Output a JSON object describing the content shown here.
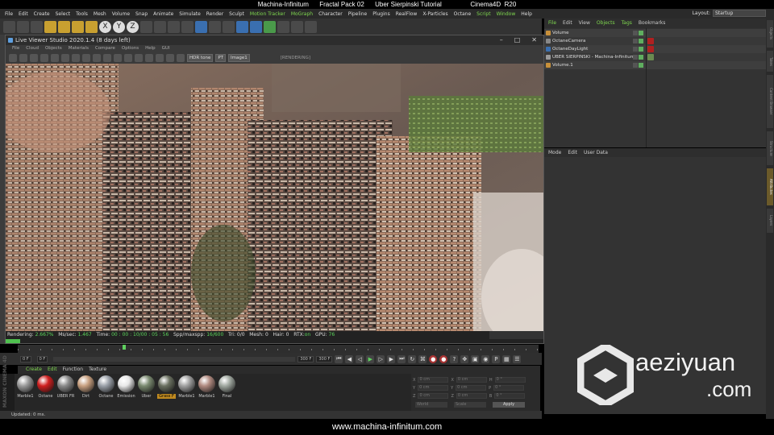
{
  "top_caption": "Machina-Infinitum      Fractal Pack 02      Uber Sierpinski Tutorial                Cinema4D  R20",
  "menubar": {
    "items": [
      "File",
      "Edit",
      "Create",
      "Select",
      "Tools",
      "Mesh",
      "Volume",
      "Snap",
      "Animate",
      "Simulate",
      "Render",
      "Sculpt",
      "Motion Tracker",
      "MoGraph",
      "Character",
      "Pipeline",
      "Plugins",
      "RealFlow",
      "X-Particles",
      "Octane",
      "Script",
      "Window",
      "Help"
    ],
    "highlighted": [
      "Motion Tracker",
      "MoGraph",
      "Script",
      "Window"
    ],
    "layout_label": "Layout:",
    "layout_value": "Startup"
  },
  "toolbar": {
    "icons": [
      "undo-icon",
      "redo-icon",
      "select-icon",
      "move-icon",
      "scale-icon",
      "rotate-icon",
      "add-icon",
      "x-axis-icon",
      "y-axis-icon",
      "z-axis-icon",
      "coord-system-icon",
      "render-region-icon",
      "render-view-icon",
      "render-settings-icon",
      "cube-icon",
      "pen-icon",
      "subdivide-icon",
      "cloner-icon",
      "deformer-icon",
      "scene-icon",
      "floor-icon",
      "camera-icon",
      "light-icon"
    ],
    "axis_labels": [
      "X",
      "Y",
      "Z"
    ]
  },
  "live_viewer": {
    "title": "Live Viewer Studio 2020.1.4 (8 days left)",
    "menu": [
      "File",
      "Cloud",
      "Objects",
      "Materials",
      "Compare",
      "Options",
      "Help",
      "GUI"
    ],
    "rendering_tag": "[RENDERING]",
    "tone": "HDR tone",
    "kernel": "PT",
    "image_slot": "Image1",
    "status": {
      "rendering_label": "Rendering: ",
      "rendering_value": "2.667%",
      "ms_label": "   Ms/sec: ",
      "ms_value": "1.467",
      "time_label": "   Time: ",
      "time_value": "00 : 00 : 10/00 : 05 : 56",
      "spp_label": "   Spp/maxspp: ",
      "spp_value": "16/600",
      "tri": "   Tri: 0/0   Mesh: 0   Hair: 0   RTX:",
      "rtx_value": "on",
      "gpu_label": "   GPU: ",
      "gpu_value": "76"
    },
    "progress": 0.02667
  },
  "transport": {
    "start_frame": "0 F",
    "current_frame": "0 F",
    "end_frame": "300 F",
    "end_frame2": "300 F"
  },
  "material_manager": {
    "menu": [
      "Create",
      "Edit",
      "Function",
      "Texture"
    ],
    "materials": [
      {
        "name": "Marble1",
        "color": "#9a9a9a"
      },
      {
        "name": "Octane",
        "color": "#d02020"
      },
      {
        "name": "UBER FR",
        "color": "#8a8a8a"
      },
      {
        "name": "Dirt",
        "color": "#c8a080"
      },
      {
        "name": "Octane",
        "color": "#9aa0a8"
      },
      {
        "name": "Emission",
        "color": "#e8e8e8"
      },
      {
        "name": "Uber",
        "color": "#7a8a70"
      },
      {
        "name": "Grass F",
        "color": "#6a7060",
        "selected": true
      },
      {
        "name": "Marble1",
        "color": "#a0a0a0"
      },
      {
        "name": "Marble1",
        "color": "#b08a80"
      },
      {
        "name": "Final",
        "color": "#a0a8a0"
      }
    ]
  },
  "coordinates": {
    "rows": [
      [
        "X",
        "0 cm",
        "X",
        "0 cm",
        "H",
        "0 °"
      ],
      [
        "Y",
        "0 cm",
        "Y",
        "0 cm",
        "P",
        "0 °"
      ],
      [
        "Z",
        "0 cm",
        "Z",
        "0 cm",
        "B",
        "0 °"
      ]
    ],
    "mode1": "World",
    "mode2": "Scale",
    "apply": "Apply"
  },
  "maxon_logo": "MAXON CINEMA 4D",
  "status_bar": "Updated: 0 ms.",
  "bottom_caption": "www.machina-infinitum.com",
  "object_manager": {
    "menu": [
      "File",
      "Edit",
      "View",
      "Objects",
      "Tags",
      "Bookmarks"
    ],
    "highlighted": [
      "File",
      "Objects",
      "Tags"
    ],
    "objects": [
      {
        "name": "Volume",
        "icon": "#c8903a",
        "tag": ""
      },
      {
        "name": "OctaneCamera",
        "icon": "#888888",
        "tag": "#b02020"
      },
      {
        "name": "OctaneDayLight",
        "icon": "#3a6fb0",
        "tag": "#b02020"
      },
      {
        "name": "UBER SIERPINSKI - Machina-Infinitum",
        "icon": "#9a9a9a",
        "tag": "#6a8a50"
      },
      {
        "name": "Volume.1",
        "icon": "#c8903a",
        "tag": ""
      }
    ]
  },
  "attribute_manager": {
    "menu": [
      "Mode",
      "Edit",
      "User Data"
    ]
  },
  "right_tabs": [
    "Objects",
    "Takes",
    "Content Browser",
    "Structure",
    "Attributes",
    "Layers"
  ],
  "watermark": {
    "line1": "aeziyuan",
    "line2": ".com"
  }
}
